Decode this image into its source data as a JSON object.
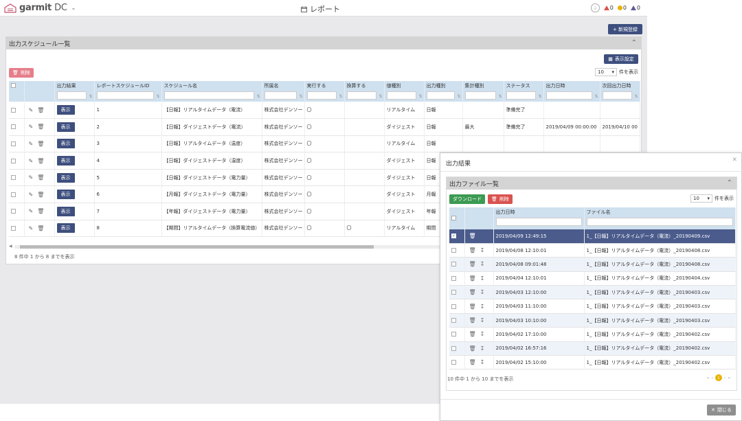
{
  "app": {
    "logo_brand": "garmit",
    "logo_suffix": "DC",
    "page_title": "レポート"
  },
  "alerts": [
    {
      "color": "#d9534f",
      "count": "0"
    },
    {
      "color": "#e8b100",
      "count": "0"
    },
    {
      "color": "#5b5b9b",
      "count": "0"
    }
  ],
  "toolbar": {
    "new_label": "+ 新規登録"
  },
  "schedule": {
    "title": "出力スケジュール一覧",
    "display_settings_label": "表示設定",
    "delete_label": "削除",
    "per_page_value": "10",
    "per_page_suffix": "件を表示",
    "columns": [
      "出力結果",
      "レポートスケジュールID",
      "スケジュール名",
      "所属名",
      "実行する",
      "換算する",
      "値種別",
      "出力種別",
      "集計種別",
      "ステータス",
      "出力日時",
      "次回出力日時"
    ],
    "show_label": "表示",
    "rows": [
      {
        "id": "1",
        "name": "【日報】リアルタイムデータ（電流）",
        "org": "株式会社デンソー",
        "exec": "〇",
        "conv": "",
        "vtype": "リアルタイム",
        "otype": "日報",
        "agg": "",
        "status": "準備完了",
        "out": "",
        "next": ""
      },
      {
        "id": "2",
        "name": "【日報】ダイジェストデータ（電流）",
        "org": "株式会社デンソー",
        "exec": "〇",
        "conv": "",
        "vtype": "ダイジェスト",
        "otype": "日報",
        "agg": "最大",
        "status": "準備完了",
        "out": "2019/04/09 00:00:00",
        "next": "2019/04/10 00"
      },
      {
        "id": "3",
        "name": "【日報】リアルタイムデータ（温度）",
        "org": "株式会社デンソー",
        "exec": "〇",
        "conv": "",
        "vtype": "リアルタイム",
        "otype": "日報",
        "agg": "",
        "status": "",
        "out": "",
        "next": ""
      },
      {
        "id": "4",
        "name": "【日報】ダイジェストデータ（温度）",
        "org": "株式会社デンソー",
        "exec": "〇",
        "conv": "",
        "vtype": "ダイジェスト",
        "otype": "日報",
        "agg": "",
        "status": "",
        "out": "",
        "next": ""
      },
      {
        "id": "5",
        "name": "【日報】ダイジェストデータ（電力量）",
        "org": "株式会社デンソー",
        "exec": "〇",
        "conv": "",
        "vtype": "ダイジェスト",
        "otype": "日報",
        "agg": "",
        "status": "",
        "out": "",
        "next": ""
      },
      {
        "id": "6",
        "name": "【月報】ダイジェストデータ（電力量）",
        "org": "株式会社デンソー",
        "exec": "〇",
        "conv": "",
        "vtype": "ダイジェスト",
        "otype": "月報",
        "agg": "",
        "status": "",
        "out": "",
        "next": ""
      },
      {
        "id": "7",
        "name": "【年報】ダイジェストデータ（電力量）",
        "org": "株式会社デンソー",
        "exec": "〇",
        "conv": "",
        "vtype": "ダイジェスト",
        "otype": "年報",
        "agg": "",
        "status": "",
        "out": "",
        "next": ""
      },
      {
        "id": "8",
        "name": "【期間】リアルタイムデータ（換算電流値）",
        "org": "株式会社デンソー",
        "exec": "〇",
        "conv": "〇",
        "vtype": "リアルタイム",
        "otype": "期間",
        "agg": "",
        "status": "",
        "out": "",
        "next": ""
      }
    ],
    "footer": "8 件中 1 から 8 までを表示"
  },
  "modal": {
    "title": "出力結果",
    "card_title": "出力ファイル一覧",
    "download_label": "ダウンロード",
    "delete_label": "削除",
    "per_page_value": "10",
    "per_page_suffix": "件を表示",
    "columns": [
      "出力日時",
      "ファイル名"
    ],
    "rows": [
      {
        "date": "2019/04/09 12:49:15",
        "file": "1_【日報】リアルタイムデータ（電流）_20190409.csv",
        "checked": true
      },
      {
        "date": "2019/04/08 12:10:01",
        "file": "1_【日報】リアルタイムデータ（電流）_20190408.csv",
        "checked": false
      },
      {
        "date": "2019/04/08 09:01:48",
        "file": "1_【日報】リアルタイムデータ（電流）_20190408.csv",
        "checked": false
      },
      {
        "date": "2019/04/04 12:10:01",
        "file": "1_【日報】リアルタイムデータ（電流）_20190404.csv",
        "checked": false
      },
      {
        "date": "2019/04/03 12:10:00",
        "file": "1_【日報】リアルタイムデータ（電流）_20190403.csv",
        "checked": false
      },
      {
        "date": "2019/04/03 11:10:00",
        "file": "1_【日報】リアルタイムデータ（電流）_20190403.csv",
        "checked": false
      },
      {
        "date": "2019/04/03 10:10:00",
        "file": "1_【日報】リアルタイムデータ（電流）_20190403.csv",
        "checked": false
      },
      {
        "date": "2019/04/02 17:10:00",
        "file": "1_【日報】リアルタイムデータ（電流）_20190402.csv",
        "checked": false
      },
      {
        "date": "2019/04/02 16:57:16",
        "file": "1_【日報】リアルタイムデータ（電流）_20190402.csv",
        "checked": false
      },
      {
        "date": "2019/04/02 15:10:00",
        "file": "1_【日報】リアルタイムデータ（電流）_20190402.csv",
        "checked": false
      }
    ],
    "footer": "10 件中 1 から 10 までを表示",
    "current_page": "1",
    "close_label": "閉じる"
  }
}
